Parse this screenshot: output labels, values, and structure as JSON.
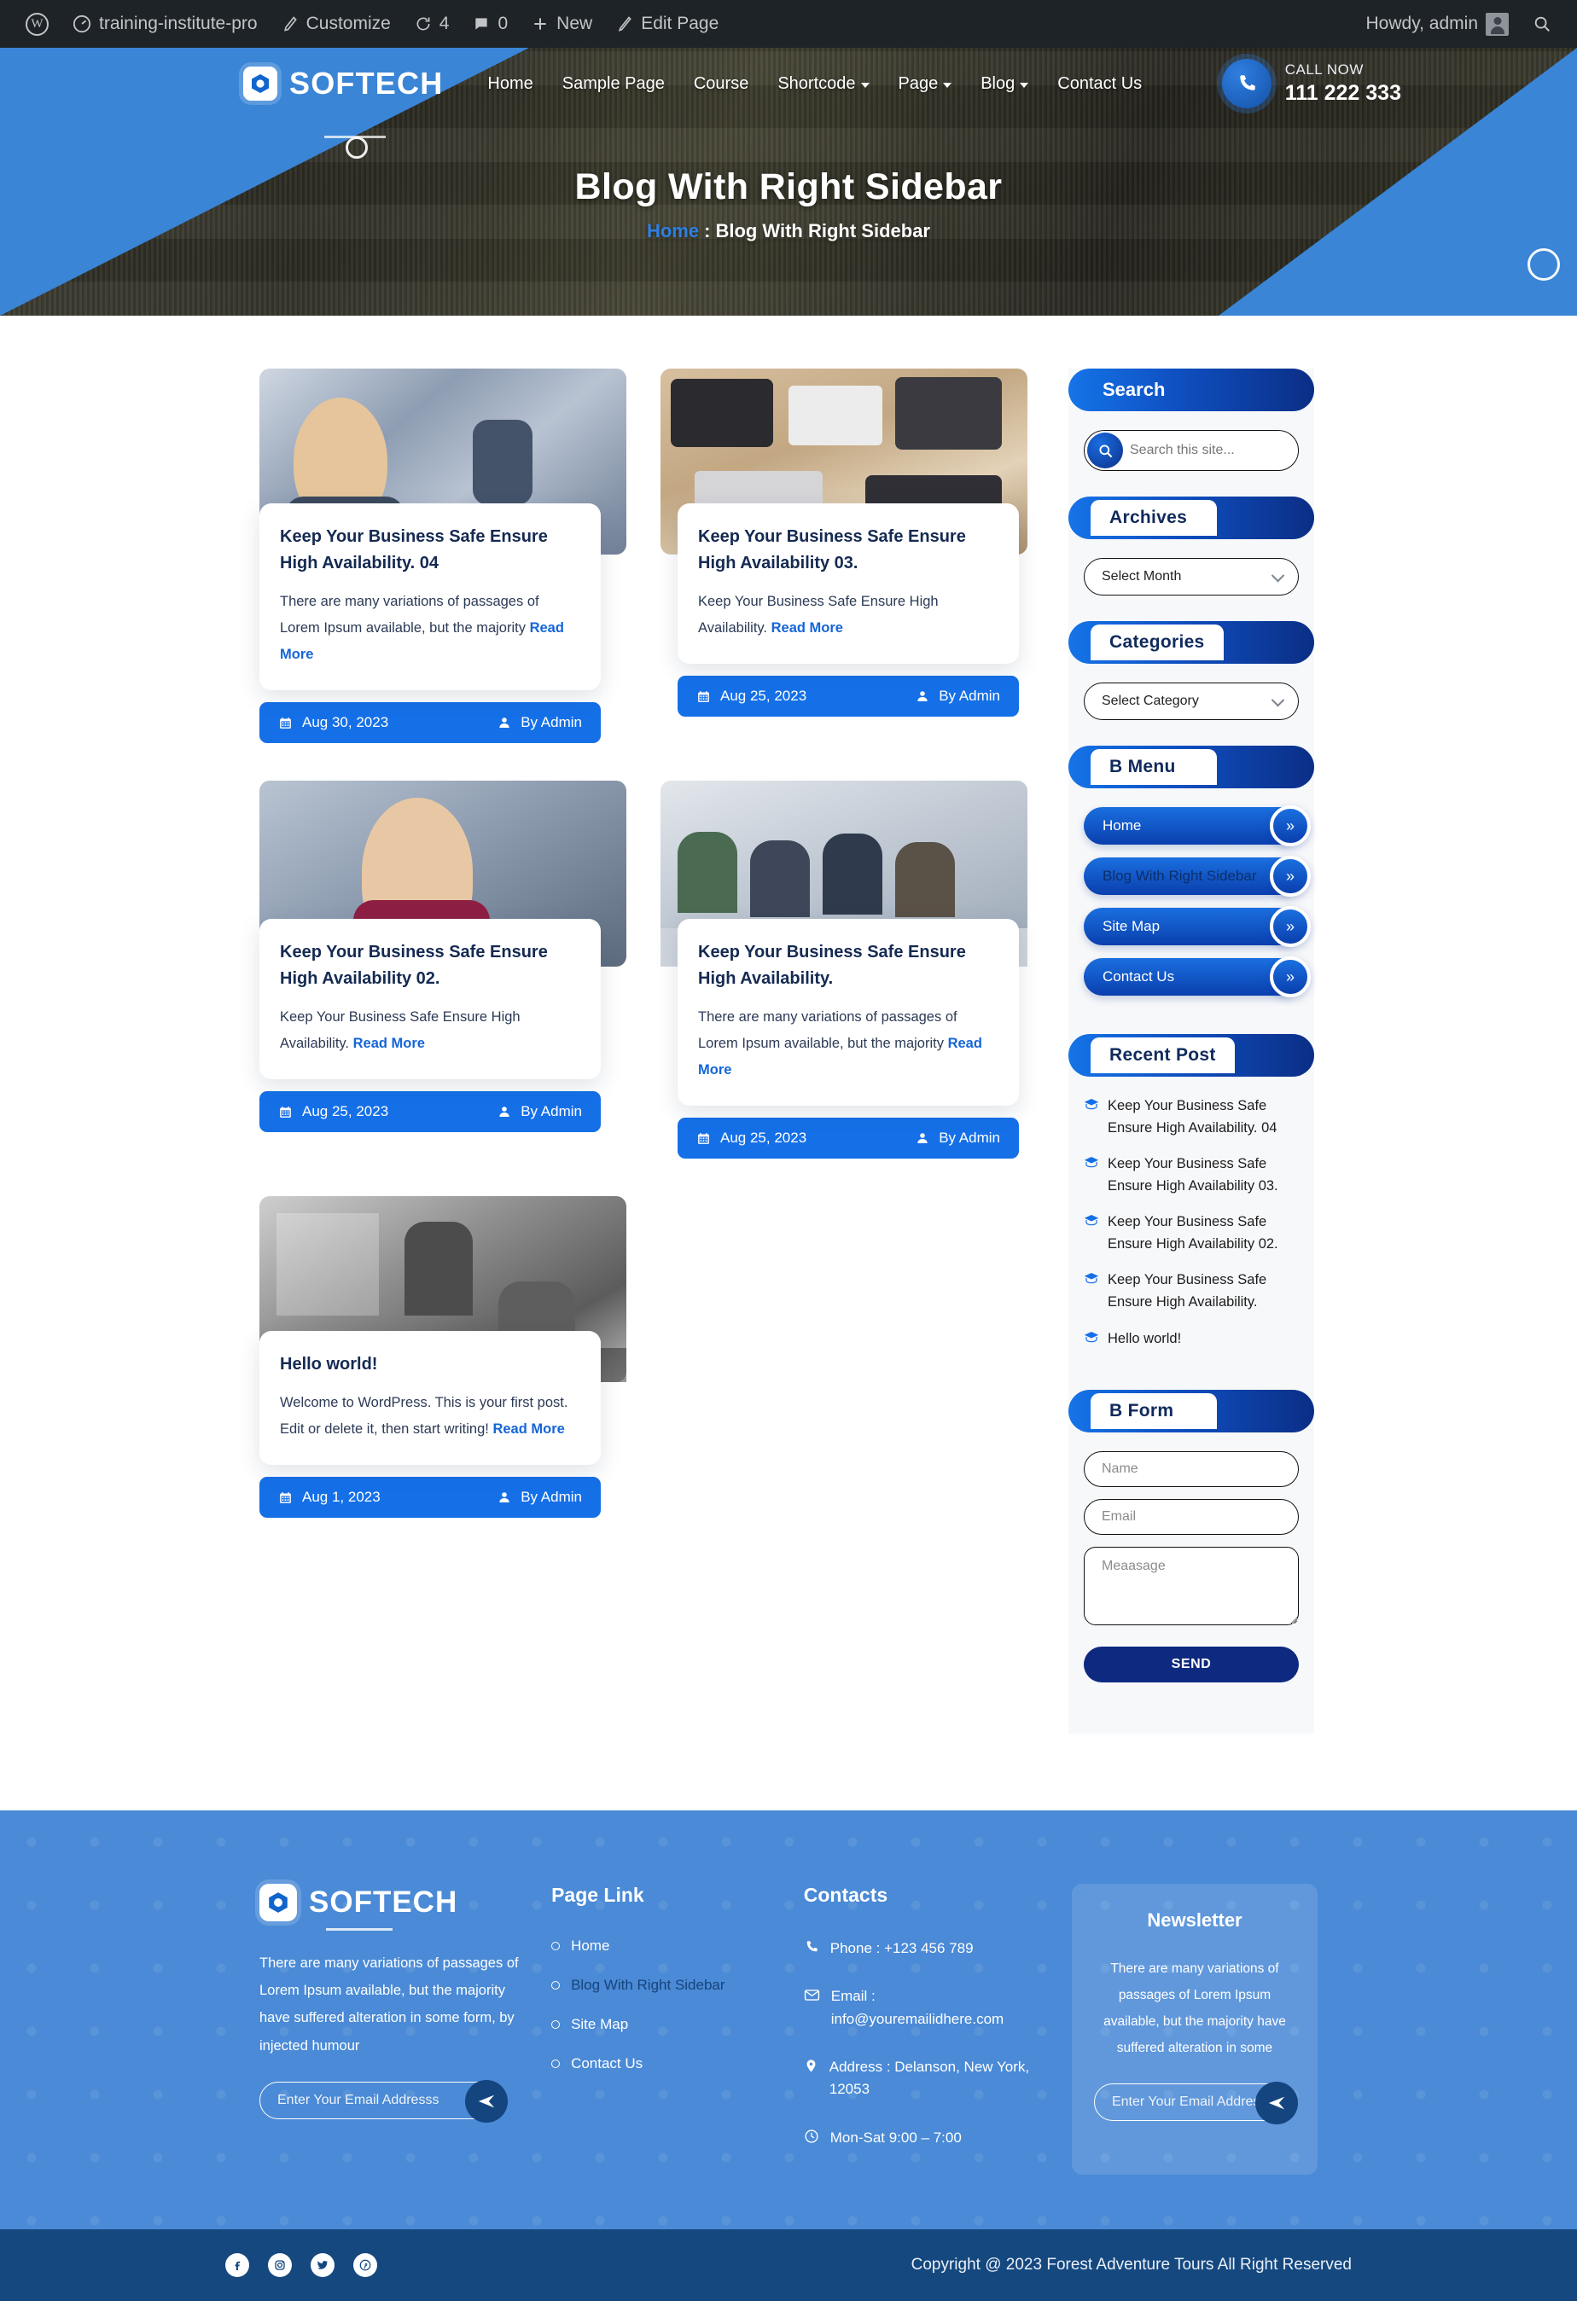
{
  "adminbar": {
    "wp_logo": "wordpress-icon",
    "site_name": "training-institute-pro",
    "customize": "Customize",
    "updates_count": "4",
    "comments_count": "0",
    "new": "New",
    "edit_page": "Edit Page",
    "howdy": "Howdy, admin",
    "search_icon": "search-icon"
  },
  "header": {
    "brand": "SOFTECH",
    "nav": [
      {
        "label": "Home",
        "caret": false
      },
      {
        "label": "Sample Page",
        "caret": false
      },
      {
        "label": "Course",
        "caret": false
      },
      {
        "label": "Shortcode",
        "caret": true
      },
      {
        "label": "Page",
        "caret": true
      },
      {
        "label": "Blog",
        "caret": true
      },
      {
        "label": "Contact Us",
        "caret": false
      }
    ],
    "call_label": "CALL NOW",
    "call_number": "111 222 333"
  },
  "hero": {
    "title": "Blog With Right Sidebar",
    "breadcrumb_home": "Home",
    "breadcrumb_sep": ":",
    "breadcrumb_current": "Blog With Right Sidebar"
  },
  "posts": [
    {
      "title": "Keep Your Business Safe Ensure High Availability. 04",
      "excerpt": "There are many variations of passages of Lorem Ipsum available, but the majority",
      "read_more": "Read More",
      "date": "Aug 30, 2023",
      "author": "By Admin"
    },
    {
      "title": "Keep Your Business Safe Ensure High Availability 03.",
      "excerpt": "Keep Your Business Safe Ensure High Availability.",
      "read_more": "Read More",
      "date": "Aug 25, 2023",
      "author": "By Admin"
    },
    {
      "title": "Keep Your Business Safe Ensure High Availability 02.",
      "excerpt": "Keep Your Business Safe Ensure High Availability.",
      "read_more": "Read More",
      "date": "Aug 25, 2023",
      "author": "By Admin"
    },
    {
      "title": "Keep Your Business Safe Ensure High Availability.",
      "excerpt": "There are many variations of passages of Lorem Ipsum available, but the majority",
      "read_more": "Read More",
      "date": "Aug 25, 2023",
      "author": "By Admin"
    },
    {
      "title": "Hello world!",
      "excerpt": "Welcome to WordPress. This is your first post. Edit or delete it, then start writing!",
      "read_more": "Read More",
      "date": "Aug 1, 2023",
      "author": "By Admin"
    }
  ],
  "sidebar": {
    "search": {
      "title": "Search",
      "placeholder": "Search this site...",
      "icon": "search-icon"
    },
    "archives": {
      "title": "Archives",
      "selected": "Select Month"
    },
    "categories": {
      "title": "Categories",
      "selected": "Select Category"
    },
    "bmenu": {
      "title": "B Menu",
      "items": [
        {
          "label": "Home",
          "current": false
        },
        {
          "label": "Blog With Right Sidebar",
          "current": true
        },
        {
          "label": "Site Map",
          "current": false
        },
        {
          "label": "Contact Us",
          "current": false
        }
      ]
    },
    "recent": {
      "title": "Recent Post",
      "items": [
        "Keep Your Business Safe Ensure High Availability. 04",
        "Keep Your Business Safe Ensure High Availability 03.",
        "Keep Your Business Safe Ensure High Availability 02.",
        "Keep Your Business Safe Ensure High Availability.",
        "Hello world!"
      ]
    },
    "bform": {
      "title": "B Form",
      "name_placeholder": "Name",
      "email_placeholder": "Email",
      "message_placeholder": "Meaasage",
      "send_label": "SEND"
    }
  },
  "footer": {
    "brand": "SOFTECH",
    "about": "There are many variations of passages of Lorem Ipsum available, but the majority have suffered alteration in some form, by injected humour",
    "email_placeholder": "Enter Your Email Addresss",
    "page_link_title": "Page Link",
    "page_links": [
      {
        "label": "Home",
        "current": false
      },
      {
        "label": "Blog With Right Sidebar",
        "current": true
      },
      {
        "label": "Site Map",
        "current": false
      },
      {
        "label": "Contact Us",
        "current": false
      }
    ],
    "contacts_title": "Contacts",
    "contacts": [
      {
        "icon": "phone-icon",
        "text": "Phone : +123 456 789"
      },
      {
        "icon": "mail-icon",
        "text": "Email : info@youremailidhere.com"
      },
      {
        "icon": "location-pin-icon",
        "text": "Address : Delanson, New York, 12053"
      },
      {
        "icon": "clock-icon",
        "text": "Mon-Sat 9:00 – 7:00"
      }
    ],
    "newsletter_title": "Newsletter",
    "newsletter_text": "There are many variations of passages of Lorem Ipsum available, but the majority have suffered alteration in some",
    "newsletter_placeholder": "Enter Your Email Addresss",
    "socials": [
      "facebook-icon",
      "instagram-icon",
      "twitter-icon",
      "pinterest-icon"
    ],
    "copyright": "Copyright @ 2023 Forest Adventure Tours All Right Reserved"
  },
  "colors": {
    "accent_blue": "#1570e8",
    "deep_blue": "#0b2e86",
    "footer_blue": "#4a8ad6",
    "copyright_blue": "#15487f",
    "title_navy": "#152a52"
  }
}
